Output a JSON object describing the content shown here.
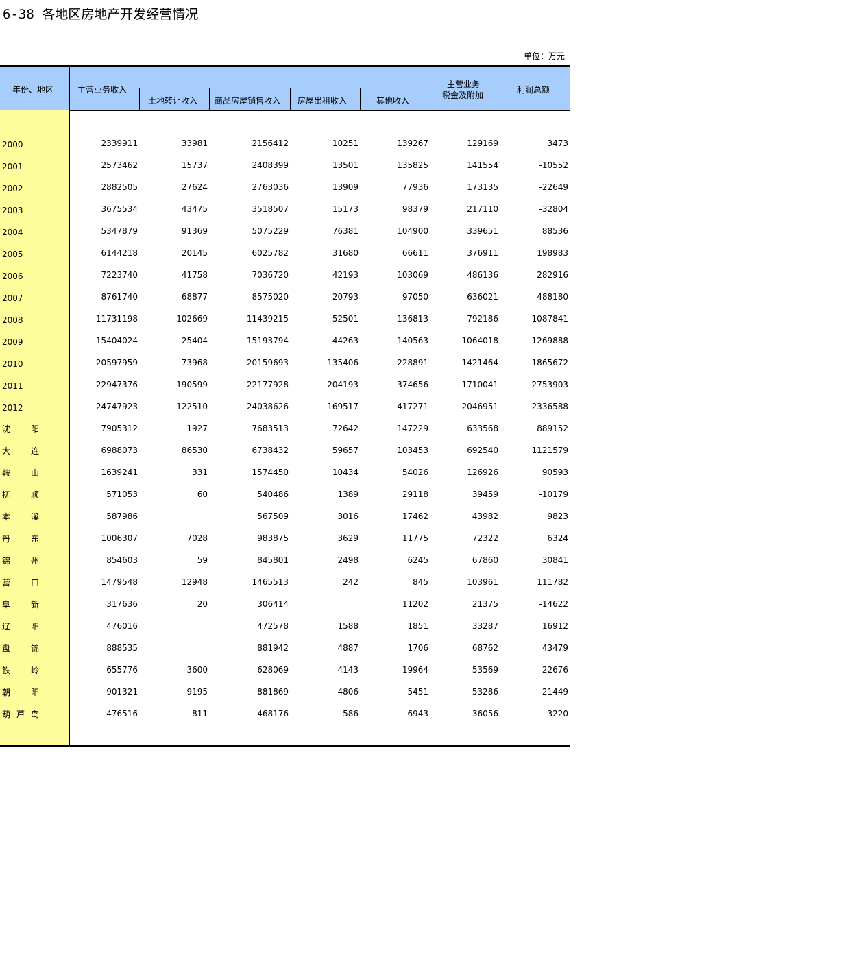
{
  "title": "6-38  各地区房地产开发经营情况",
  "unit": "单位：万元",
  "header": {
    "stub": "年份、地区",
    "main_income": "主营业务收入",
    "land": "土地转让收入",
    "sales": "商品房屋销售收入",
    "rent": "房屋出租收入",
    "other": "其他收入",
    "tax_line1": "主营业务",
    "tax_line2": "税金及附加",
    "profit": "利润总额"
  },
  "rows": [
    {
      "label": "2000",
      "region": false,
      "values": [
        "2339911",
        "33981",
        "2156412",
        "10251",
        "139267",
        "129169",
        "3473"
      ]
    },
    {
      "label": "2001",
      "region": false,
      "values": [
        "2573462",
        "15737",
        "2408399",
        "13501",
        "135825",
        "141554",
        "-10552"
      ]
    },
    {
      "label": "2002",
      "region": false,
      "values": [
        "2882505",
        "27624",
        "2763036",
        "13909",
        "77936",
        "173135",
        "-22649"
      ]
    },
    {
      "label": "2003",
      "region": false,
      "values": [
        "3675534",
        "43475",
        "3518507",
        "15173",
        "98379",
        "217110",
        "-32804"
      ]
    },
    {
      "label": "2004",
      "region": false,
      "values": [
        "5347879",
        "91369",
        "5075229",
        "76381",
        "104900",
        "339651",
        "88536"
      ]
    },
    {
      "label": "2005",
      "region": false,
      "values": [
        "6144218",
        "20145",
        "6025782",
        "31680",
        "66611",
        "376911",
        "198983"
      ]
    },
    {
      "label": "2006",
      "region": false,
      "values": [
        "7223740",
        "41758",
        "7036720",
        "42193",
        "103069",
        "486136",
        "282916"
      ]
    },
    {
      "label": "2007",
      "region": false,
      "values": [
        "8761740",
        "68877",
        "8575020",
        "20793",
        "97050",
        "636021",
        "488180"
      ]
    },
    {
      "label": "2008",
      "region": false,
      "values": [
        "11731198",
        "102669",
        "11439215",
        "52501",
        "136813",
        "792186",
        "1087841"
      ]
    },
    {
      "label": "2009",
      "region": false,
      "values": [
        "15404024",
        "25404",
        "15193794",
        "44263",
        "140563",
        "1064018",
        "1269888"
      ]
    },
    {
      "label": "2010",
      "region": false,
      "values": [
        "20597959",
        "73968",
        "20159693",
        "135406",
        "228891",
        "1421464",
        "1865672"
      ]
    },
    {
      "label": "2011",
      "region": false,
      "values": [
        "22947376",
        "190599",
        "22177928",
        "204193",
        "374656",
        "1710041",
        "2753903"
      ]
    },
    {
      "label": "2012",
      "region": false,
      "values": [
        "24747923",
        "122510",
        "24038626",
        "169517",
        "417271",
        "2046951",
        "2336588"
      ]
    },
    {
      "label": "沈阳",
      "region": true,
      "chars": [
        "沈",
        "阳"
      ],
      "values": [
        "7905312",
        "1927",
        "7683513",
        "72642",
        "147229",
        "633568",
        "889152"
      ]
    },
    {
      "label": "大连",
      "region": true,
      "chars": [
        "大",
        "连"
      ],
      "values": [
        "6988073",
        "86530",
        "6738432",
        "59657",
        "103453",
        "692540",
        "1121579"
      ]
    },
    {
      "label": "鞍山",
      "region": true,
      "chars": [
        "鞍",
        "山"
      ],
      "values": [
        "1639241",
        "331",
        "1574450",
        "10434",
        "54026",
        "126926",
        "90593"
      ]
    },
    {
      "label": "抚顺",
      "region": true,
      "chars": [
        "抚",
        "顺"
      ],
      "values": [
        "571053",
        "60",
        "540486",
        "1389",
        "29118",
        "39459",
        "-10179"
      ]
    },
    {
      "label": "本溪",
      "region": true,
      "chars": [
        "本",
        "溪"
      ],
      "values": [
        "587986",
        "",
        "567509",
        "3016",
        "17462",
        "43982",
        "9823"
      ]
    },
    {
      "label": "丹东",
      "region": true,
      "chars": [
        "丹",
        "东"
      ],
      "values": [
        "1006307",
        "7028",
        "983875",
        "3629",
        "11775",
        "72322",
        "6324"
      ]
    },
    {
      "label": "锦州",
      "region": true,
      "chars": [
        "锦",
        "州"
      ],
      "values": [
        "854603",
        "59",
        "845801",
        "2498",
        "6245",
        "67860",
        "30841"
      ]
    },
    {
      "label": "营口",
      "region": true,
      "chars": [
        "营",
        "口"
      ],
      "values": [
        "1479548",
        "12948",
        "1465513",
        "242",
        "845",
        "103961",
        "111782"
      ]
    },
    {
      "label": "阜新",
      "region": true,
      "chars": [
        "阜",
        "新"
      ],
      "values": [
        "317636",
        "20",
        "306414",
        "",
        "11202",
        "21375",
        "-14622"
      ]
    },
    {
      "label": "辽阳",
      "region": true,
      "chars": [
        "辽",
        "阳"
      ],
      "values": [
        "476016",
        "",
        "472578",
        "1588",
        "1851",
        "33287",
        "16912"
      ]
    },
    {
      "label": "盘锦",
      "region": true,
      "chars": [
        "盘",
        "锦"
      ],
      "values": [
        "888535",
        "",
        "881942",
        "4887",
        "1706",
        "68762",
        "43479"
      ]
    },
    {
      "label": "铁岭",
      "region": true,
      "chars": [
        "铁",
        "岭"
      ],
      "values": [
        "655776",
        "3600",
        "628069",
        "4143",
        "19964",
        "53569",
        "22676"
      ]
    },
    {
      "label": "朝阳",
      "region": true,
      "chars": [
        "朝",
        "阳"
      ],
      "values": [
        "901321",
        "9195",
        "881869",
        "4806",
        "5451",
        "53286",
        "21449"
      ]
    },
    {
      "label": "葫芦岛",
      "region": true,
      "chars": [
        "葫",
        "芦",
        "岛"
      ],
      "values": [
        "476516",
        "811",
        "468176",
        "586",
        "6943",
        "36056",
        "-3220"
      ]
    }
  ]
}
